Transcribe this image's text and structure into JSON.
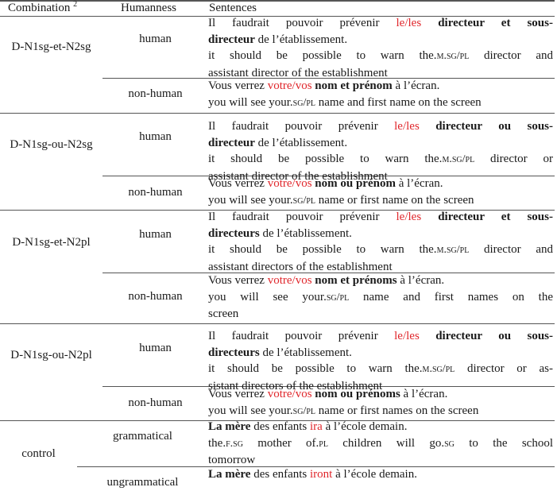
{
  "header": {
    "combination": "Combination",
    "combination_footnote": "2",
    "humanness": "Humanness",
    "sentences": "Sentences"
  },
  "groups": [
    {
      "combination": "D-N1sg-et-N2sg",
      "rows": [
        {
          "humanness": "human",
          "fr": {
            "pre": "Il faudrait pouvoir prévenir ",
            "red": "le/les",
            "bold1": " directeur et sous-",
            "bold2": "directeur",
            "post": " de l’établissement."
          },
          "en": [
            "it should be possible to warn the.",
            "m.sg/pl",
            " director and",
            "assistant director of the establishment"
          ]
        },
        {
          "humanness": "non-human",
          "fr": {
            "pre": "Vous verrez ",
            "red": "votre/vos",
            "bold": " nom et prénom",
            "post": " à l’écran."
          },
          "en": [
            "you will see your.",
            "sg/pl",
            " name and first name on the screen"
          ]
        }
      ]
    },
    {
      "combination": "D-N1sg-ou-N2sg",
      "rows": [
        {
          "humanness": "human",
          "fr": {
            "pre": "Il faudrait pouvoir prévenir ",
            "red": "le/les",
            "bold1": " directeur ou sous-",
            "bold2": "directeur",
            "post": " de l’établissement."
          },
          "en": [
            "it should be possible to warn the.",
            "m.sg/pl",
            " director or",
            "assistant director of the establishment"
          ]
        },
        {
          "humanness": "non-human",
          "fr": {
            "pre": "Vous verrez ",
            "red": "votre/vos",
            "bold": " nom ou prénom",
            "post": " à l’écran."
          },
          "en": [
            "you will see your.",
            "sg/pl",
            " name or first name on the screen"
          ]
        }
      ]
    },
    {
      "combination": "D-N1sg-et-N2pl",
      "rows": [
        {
          "humanness": "human",
          "fr": {
            "pre": "Il faudrait pouvoir prévenir ",
            "red": "le/les",
            "bold1": " directeur et sous-",
            "bold2": "directeurs",
            "post": " de l’établissement."
          },
          "en": [
            "it should be possible to warn the.",
            "m.sg/pl",
            " director and",
            "assistant directors of the establishment"
          ]
        },
        {
          "humanness": "non-human",
          "fr": {
            "pre": "Vous verrez ",
            "red": "votre/vos",
            "bold": " nom et prénoms",
            "post": " à l’écran."
          },
          "en": [
            "you will see your.",
            "sg/pl",
            " name and first names on the",
            "screen"
          ]
        }
      ]
    },
    {
      "combination": "D-N1sg-ou-N2pl",
      "rows": [
        {
          "humanness": "human",
          "fr": {
            "pre": "Il faudrait pouvoir prévenir ",
            "red": "le/les",
            "bold1": " directeur ou sous-",
            "bold2": "directeurs",
            "post": " de l’établissement."
          },
          "en": [
            "it should be possible to warn the.",
            "m.sg/pl",
            " director or as-",
            "sistant directors of the establishment"
          ]
        },
        {
          "humanness": "non-human",
          "fr": {
            "pre": "Vous verrez ",
            "red": "votre/vos",
            "bold": " nom ou prénoms",
            "post": " à l’écran."
          },
          "en": [
            "you will see your.",
            "sg/pl",
            " name or first names on the screen"
          ]
        }
      ]
    },
    {
      "combination": "control",
      "rows": [
        {
          "humanness": "grammatical",
          "fr": {
            "bold": "La mère",
            "pre": " des enfants ",
            "red": "ira",
            "post": " à l’école demain."
          },
          "en": [
            "the.",
            "f.sg",
            " mother of.",
            "pl",
            " children will go.",
            "sg",
            " to the school",
            "tomorrow"
          ]
        },
        {
          "humanness": "ungrammatical",
          "fr": {
            "bold": "La mère",
            "pre": " des enfants ",
            "red": "iront",
            "post": " à l’école demain."
          }
        }
      ]
    }
  ]
}
